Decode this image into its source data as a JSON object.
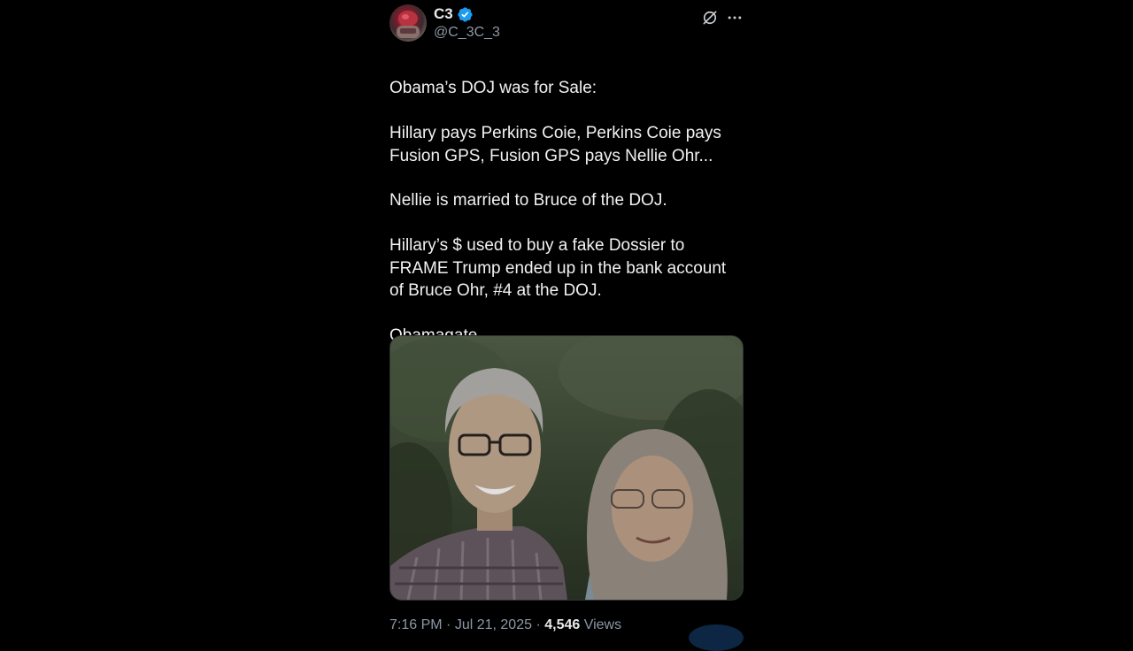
{
  "author": {
    "display_name": "C3",
    "handle": "@C_3C_3",
    "verified_icon": "verified-badge-icon"
  },
  "actions": {
    "grok_icon": "grok-icon",
    "more_icon": "more-icon"
  },
  "post": {
    "paragraphs": [
      "Obama’s DOJ was for Sale:",
      "Hillary pays Perkins Coie, Perkins Coie pays Fusion GPS, Fusion GPS pays Nellie Ohr...",
      "Nellie is married to Bruce of the DOJ.",
      "Hillary’s $ used to buy a fake Dossier to FRAME Trump ended up in the bank account of Bruce Ohr, #4 at the DOJ.",
      "Obamagate."
    ]
  },
  "meta": {
    "time": "7:16 PM",
    "separator": " · ",
    "date": "Jul 21, 2025",
    "views_count": "4,546",
    "views_label": " Views"
  },
  "colors": {
    "background": "#000000",
    "text": "#e7e9ea",
    "secondary_text": "#8b98a5",
    "verified_blue": "#1d9bf0"
  }
}
